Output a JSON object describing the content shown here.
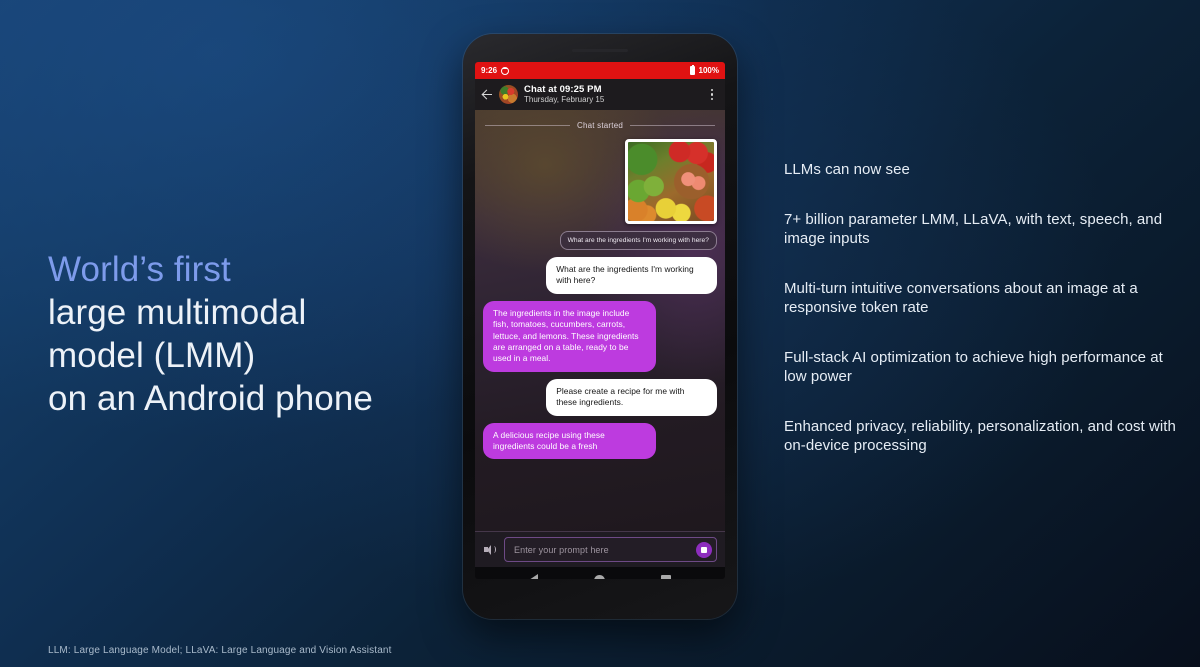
{
  "theme": {
    "bg_top_left": "#174272",
    "bg_bottom_right": "#080F1C",
    "accent_headline": "#7D9BEB",
    "status_bar_red": "#E01212",
    "bot_bubble_purple": "#BD3BDF",
    "send_button_purple": "#8D2DBE",
    "text_primary": "#EDF2F8"
  },
  "headline": {
    "line1": "World’s first",
    "line2": "large multimodal",
    "line3": "model (LMM)",
    "line4": "on an Android phone"
  },
  "bullets": [
    "LLMs can now see",
    "7+ billion parameter LMM, LLaVA, with text, speech, and image inputs",
    "Multi-turn intuitive conversations about an image at a responsive token rate",
    "Full-stack AI optimization to achieve high performance at low power",
    "Enhanced privacy, reliability, personalization, and cost with on-device processing"
  ],
  "footnote": "LLM: Large Language Model; LLaVA: Large Language and Vision Assistant",
  "phone": {
    "status_bar": {
      "time": "9:26",
      "battery_percent": "100%",
      "notification_icon": "alarm-icon",
      "battery_icon": "battery-full-icon"
    },
    "app_bar": {
      "back_icon": "back-arrow-icon",
      "avatar_icon": "chat-avatar-food-thumbnail",
      "title": "Chat at 09:25 PM",
      "subtitle": "Thursday, February 15",
      "overflow_icon": "more-vertical-icon"
    },
    "chat": {
      "divider_label": "Chat started",
      "attached_image_alt": "photo-of-fish-and-vegetables",
      "messages": [
        {
          "id": "ghost-prompt",
          "style": "ghost",
          "side": "right",
          "text": "What are the ingredients I'm working with here?"
        },
        {
          "id": "user-1",
          "style": "user",
          "side": "right",
          "text": "What are the ingredients I'm working with here?"
        },
        {
          "id": "bot-1",
          "style": "bot",
          "side": "left",
          "text": "The ingredients in the image include fish, tomatoes, cucumbers, carrots, lettuce, and lemons. These ingredients are arranged on a table, ready to be used in a meal."
        },
        {
          "id": "user-2",
          "style": "user",
          "side": "right",
          "text": "Please create a recipe for me with these ingredients."
        },
        {
          "id": "bot-2",
          "style": "bot",
          "side": "left",
          "text": "A delicious recipe using these ingredients could be a fresh"
        }
      ]
    },
    "input_bar": {
      "speaker_icon": "speaker-volume-icon",
      "placeholder": "Enter your prompt here",
      "value": "",
      "action_icon": "stop-square-icon"
    },
    "nav_bar": {
      "back_icon": "triangle-back-icon",
      "home_icon": "circle-home-icon",
      "recents_icon": "square-recents-icon"
    }
  }
}
